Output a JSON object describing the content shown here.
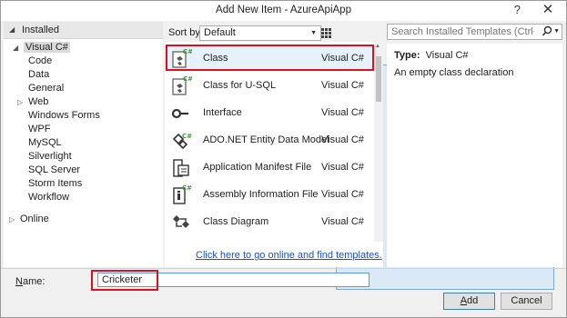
{
  "window": {
    "title": "Add New Item - AzureApiApp",
    "help": "?",
    "close": "✕"
  },
  "left_pane": {
    "header": "Installed",
    "root": "Visual C#",
    "children": [
      "Code",
      "Data",
      "General",
      "Web",
      "Windows Forms",
      "WPF",
      "MySQL",
      "Silverlight",
      "SQL Server",
      "Storm Items",
      "Workflow"
    ],
    "online": "Online"
  },
  "toolbar": {
    "sort_label": "Sort by:",
    "sort_value": "Default"
  },
  "search": {
    "placeholder": "Search Installed Templates (Ctrl+E)"
  },
  "templates": [
    {
      "name": "Class",
      "lang": "Visual C#",
      "icon": "class-icon",
      "selected": true
    },
    {
      "name": "Class for U-SQL",
      "lang": "Visual C#",
      "icon": "usql-class-icon"
    },
    {
      "name": "Interface",
      "lang": "Visual C#",
      "icon": "interface-icon"
    },
    {
      "name": "ADO.NET Entity Data Model",
      "lang": "Visual C#",
      "icon": "entity-model-icon"
    },
    {
      "name": "Application Manifest File",
      "lang": "Visual C#",
      "icon": "manifest-icon"
    },
    {
      "name": "Assembly Information File",
      "lang": "Visual C#",
      "icon": "assembly-info-icon"
    },
    {
      "name": "Class Diagram",
      "lang": "Visual C#",
      "icon": "class-diagram-icon"
    }
  ],
  "online_link": "Click here to go online and find templates.",
  "details": {
    "type_label": "Type:",
    "type_value": "Visual C#",
    "description": "An empty class declaration"
  },
  "name_field": {
    "label_first": "N",
    "label_rest": "ame:",
    "value": "Cricketer"
  },
  "buttons": {
    "add_first": "A",
    "add_rest": "dd",
    "cancel": "Cancel"
  },
  "colors": {
    "highlight": "#d9131d",
    "link": "#1a53c5",
    "selected_row": "#e5f1fb"
  }
}
